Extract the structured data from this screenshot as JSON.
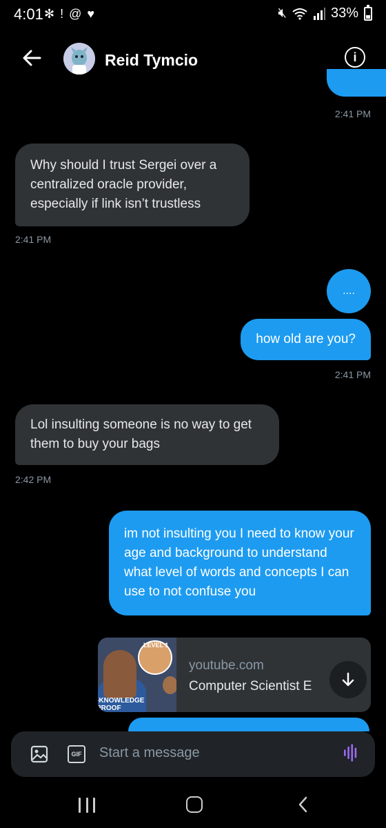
{
  "status_bar": {
    "time": "4:01",
    "battery": "33%",
    "battery_level": 0.33
  },
  "header": {
    "contact_name": "Reid Tymcio"
  },
  "messages": [
    {
      "direction": "out",
      "text": "",
      "timestamp": "2:41 PM"
    },
    {
      "direction": "in",
      "text": "Why should I trust Sergei over a centralized oracle provider, especially if link isn’t trustless",
      "timestamp": "2:41 PM"
    },
    {
      "direction": "out",
      "text": "....",
      "timestamp": ""
    },
    {
      "direction": "out",
      "text": "how old are you?",
      "timestamp": "2:41 PM"
    },
    {
      "direction": "in",
      "text": "Lol insulting someone is no way to get them to buy your bags",
      "timestamp": "2:42 PM"
    },
    {
      "direction": "out",
      "text": "im not insulting you I need to know your age and background to understand what level of words and concepts I can use to not confuse you",
      "timestamp": ""
    }
  ],
  "link_card": {
    "thumbnail_badge": "LEVEL 1",
    "thumbnail_caption": "-KNOWLEDGE PROOF",
    "domain": "youtube.com",
    "title": "Computer Scientist E"
  },
  "composer": {
    "placeholder": "Start a message",
    "gif_label": "GIF"
  },
  "colors": {
    "accent": "#1d9bf0",
    "incoming_bubble": "#2f3336",
    "background": "#000000",
    "muted_text": "#8b98a5",
    "voice_icon": "#9b6bf2"
  },
  "icons": {
    "back": "arrow-left-icon",
    "info": "info-icon",
    "image": "image-icon",
    "gif": "gif-icon",
    "voice": "voice-wave-icon",
    "download": "arrow-down-icon"
  }
}
